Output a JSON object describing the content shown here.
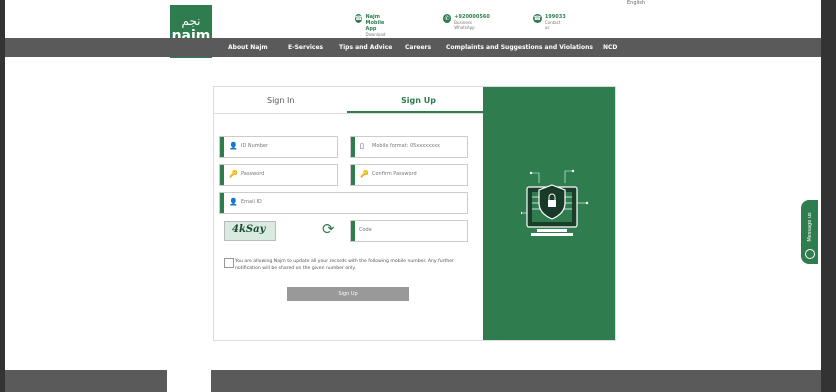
{
  "topstrip": {
    "lang": "English"
  },
  "logo": {
    "arabic": "نجم",
    "english": "najm"
  },
  "contacts": [
    {
      "icon": "phone-icon",
      "line1": "Najm Mobile App",
      "line2": "Download Najm App"
    },
    {
      "icon": "whatsapp-icon",
      "line1": "+920000560",
      "line2": "Business WhatsApp"
    },
    {
      "icon": "phone-icon",
      "line1": "199033",
      "line2": "Contact us"
    }
  ],
  "nav": {
    "items": [
      "About Najm",
      "E-Services",
      "Tips and Advice",
      "Careers",
      "Complaints and Suggestions and Violations",
      "NCD"
    ]
  },
  "form": {
    "tabs": [
      "Sign In",
      "Sign Up"
    ],
    "fields": {
      "id_number": "ID Number",
      "mobile": "Mobile format: 05xxxxxxxx",
      "password": "Password",
      "confirm_password": "Confirm Password",
      "email": "Email ID",
      "code": "Code"
    },
    "captcha": "4kSay",
    "consent": "You are allowing Najm to update all your records with the following mobile number. Any further notification will be shared on the given number only.",
    "submit": "Sign Up"
  },
  "message_us": "Message us",
  "colors": {
    "brand": "#2f7d4f",
    "nav": "#5a5a5a"
  }
}
